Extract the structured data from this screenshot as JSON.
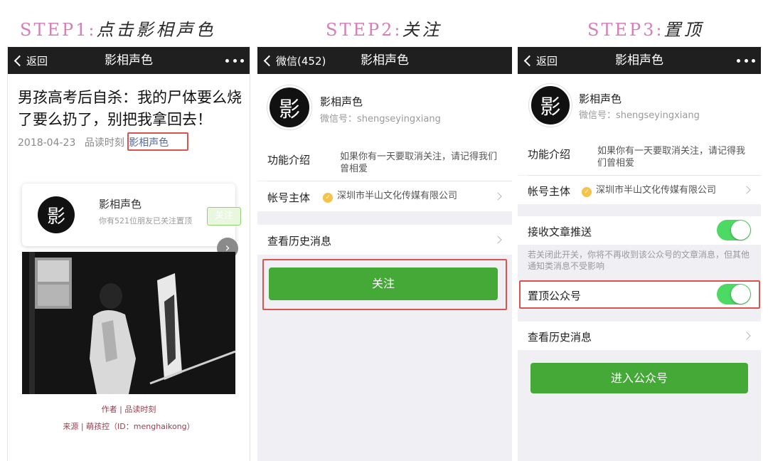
{
  "steps": [
    {
      "prefix": "STEP1:",
      "label": "点击影相声色"
    },
    {
      "prefix": "STEP2:",
      "label": "关注"
    },
    {
      "prefix": "STEP3:",
      "label": "置顶"
    }
  ],
  "panel1": {
    "nav": {
      "back": "返回",
      "title": "影相声色"
    },
    "article_title": "男孩高考后自杀：我的尸体要么烧了要么扔了，别把我拿回去！",
    "date": "2018-04-23",
    "author": "品读时刻",
    "account_link": "影相声色",
    "card": {
      "name": "影相声色",
      "subtitle": "你有521位朋友已关注置顶",
      "follow": "关注"
    },
    "logo_char": "影",
    "credit_author": "作者 | 品读时刻",
    "credit_source": "来源 | 萌孩控（ID：menghaikong）"
  },
  "panel2": {
    "nav": {
      "back": "微信(452)",
      "title": "影相声色"
    },
    "name": "影相声色",
    "wechat_id": "微信号：shengseyingxiang",
    "intro_label": "功能介绍",
    "intro_value": "如果你有一天要取消关注，请记得我们曾相爱",
    "owner_label": "帐号主体",
    "owner_value": "深圳市半山文化传媒有限公司",
    "history_label": "查看历史消息",
    "follow_button": "关注"
  },
  "panel3": {
    "nav": {
      "back": "返回",
      "title": "影相声色"
    },
    "name": "影相声色",
    "wechat_id": "微信号：shengseyingxiang",
    "intro_label": "功能介绍",
    "intro_value": "如果你有一天要取消关注，请记得我们曾相爱",
    "owner_label": "帐号主体",
    "owner_value": "深圳市半山文化传媒有限公司",
    "receive_label": "接收文章推送",
    "receive_hint": "若关闭此开关，你将不再收到该公众号的文章消息，但其他通知类消息不受影响",
    "pin_label": "置顶公众号",
    "history_label": "查看历史消息",
    "enter_button": "进入公众号",
    "toggles": {
      "receive_on": true,
      "pin_on": true
    }
  },
  "colors": {
    "accent_green": "#44a937",
    "toggle_green": "#4cd964",
    "highlight_red": "#d9534f",
    "step_pink": "#d47fb6",
    "link_blue": "#576b95"
  }
}
